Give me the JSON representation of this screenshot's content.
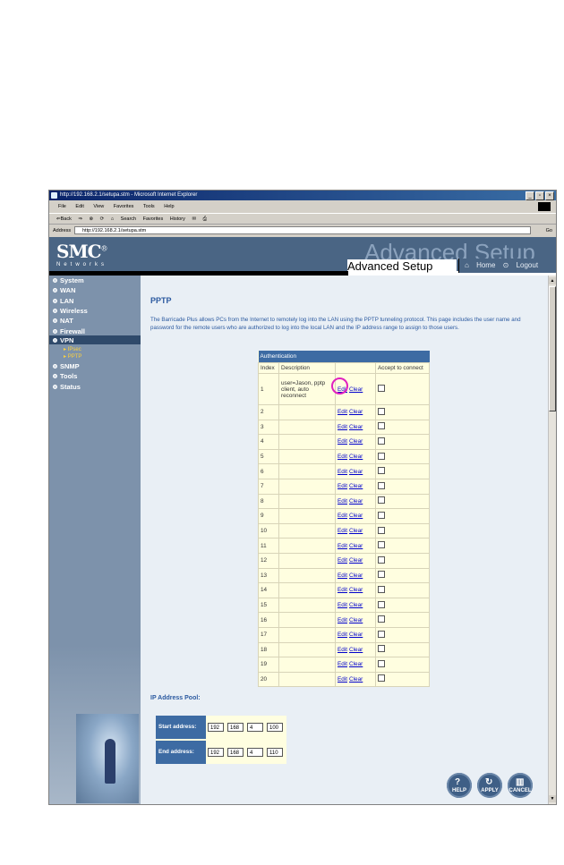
{
  "window": {
    "title": "http://192.168.2.1/setupa.stm - Microsoft Internet Explorer",
    "menu": [
      "File",
      "Edit",
      "View",
      "Favorites",
      "Tools",
      "Help"
    ],
    "toolbar": [
      "⇐Back",
      "⇒",
      "Search",
      "Favorites",
      "History"
    ],
    "address_label": "Address",
    "address": "http://192.168.2.1/setupa.stm",
    "go_label": "Go"
  },
  "header": {
    "brand": "SMC",
    "brand_mark": "®",
    "brand_sub": "Networks",
    "big_text": "Advanced Setup",
    "title": "Advanced Setup",
    "home": "Home",
    "logout": "Logout"
  },
  "sidebar": {
    "items": [
      {
        "label": "System"
      },
      {
        "label": "WAN"
      },
      {
        "label": "LAN"
      },
      {
        "label": "Wireless"
      },
      {
        "label": "NAT"
      },
      {
        "label": "Firewall"
      },
      {
        "label": "VPN"
      },
      {
        "label": "SNMP"
      },
      {
        "label": "Tools"
      },
      {
        "label": "Status"
      }
    ],
    "vpn_sub": [
      "IPsec",
      "PPTP"
    ]
  },
  "main": {
    "title": "PPTP",
    "description": "The Barricade Plus allows PCs from the Internet to remotely log into the LAN using the PPTP tunneling protocol.  This page includes the user name and password for the remote users who are authorized to log into the local LAN and the IP address range to assign to those users.",
    "table": {
      "heading": "Authentication",
      "columns": [
        "Index",
        "Description",
        "",
        "Accept to connect"
      ],
      "edit_label": "Edit",
      "clear_label": "Clear",
      "rows": [
        {
          "index": "1",
          "description": "user=Jason, pptp client, auto reconnect"
        },
        {
          "index": "2",
          "description": ""
        },
        {
          "index": "3",
          "description": ""
        },
        {
          "index": "4",
          "description": ""
        },
        {
          "index": "5",
          "description": ""
        },
        {
          "index": "6",
          "description": ""
        },
        {
          "index": "7",
          "description": ""
        },
        {
          "index": "8",
          "description": ""
        },
        {
          "index": "9",
          "description": ""
        },
        {
          "index": "10",
          "description": ""
        },
        {
          "index": "11",
          "description": ""
        },
        {
          "index": "12",
          "description": ""
        },
        {
          "index": "13",
          "description": ""
        },
        {
          "index": "14",
          "description": ""
        },
        {
          "index": "15",
          "description": ""
        },
        {
          "index": "16",
          "description": ""
        },
        {
          "index": "17",
          "description": ""
        },
        {
          "index": "18",
          "description": ""
        },
        {
          "index": "19",
          "description": ""
        },
        {
          "index": "20",
          "description": ""
        }
      ]
    },
    "ip_pool": {
      "label": "IP Address Pool:",
      "start_label": "Start address:",
      "start": [
        "192",
        "168",
        "4",
        "100"
      ],
      "end_label": "End address:",
      "end": [
        "192",
        "168",
        "4",
        "110"
      ]
    },
    "buttons": {
      "help": "HELP",
      "apply": "APPLY",
      "cancel": "CANCEL"
    }
  },
  "colors": {
    "header_bg": "#4a6584",
    "sidebar_bg": "#7d92ab",
    "table_head": "#3d6ba3",
    "highlight_ring": "#e020c0"
  }
}
